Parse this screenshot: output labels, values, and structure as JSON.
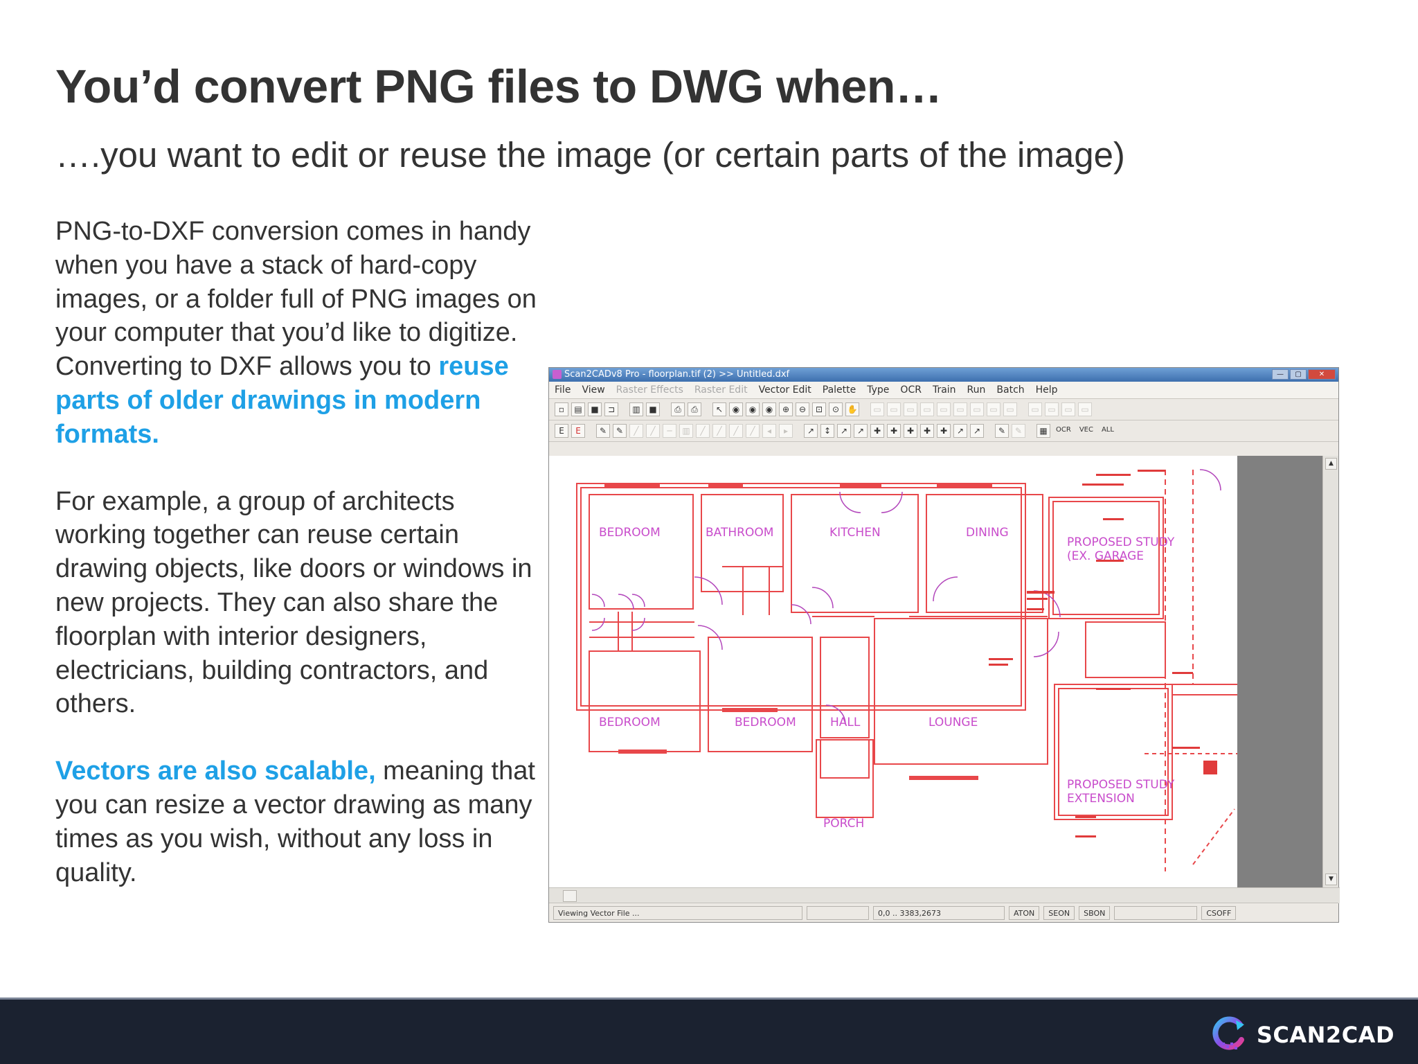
{
  "slide": {
    "title": "You’d convert PNG files to DWG when…",
    "subtitle": "….you want to edit or reuse the image (or certain parts of the image)",
    "para1_text": "PNG-to-DXF conversion comes in handy when you have a stack of hard-copy images, or a folder full of PNG images on your computer that you’d like to digitize. Converting to DXF allows you to ",
    "para1_highlight": "reuse parts of older drawings in modern formats.",
    "para2_text": "For example, a group of architects working together can reuse certain drawing objects, like doors or windows in new projects. They can also share the floorplan with interior designers, electricians, building contractors, and others.",
    "para3_highlight": "Vectors are also scalable,",
    "para3_text": " meaning that you can resize a vector drawing as many times as you wish, without any loss in quality.",
    "highlight_color": "#1ea0e6"
  },
  "app_window": {
    "title": "Scan2CADv8 Pro  -  floorplan.tif (2) >> Untitled.dxf",
    "window_buttons": [
      "—",
      "▢",
      "✕"
    ],
    "menu": [
      {
        "label": "File",
        "enabled": true
      },
      {
        "label": "View",
        "enabled": true
      },
      {
        "label": "Raster Effects",
        "enabled": false
      },
      {
        "label": "Raster Edit",
        "enabled": false
      },
      {
        "label": "Vector Edit",
        "enabled": true
      },
      {
        "label": "Palette",
        "enabled": true
      },
      {
        "label": "Type",
        "enabled": true
      },
      {
        "label": "OCR",
        "enabled": true
      },
      {
        "label": "Train",
        "enabled": true
      },
      {
        "label": "Run",
        "enabled": true
      },
      {
        "label": "Batch",
        "enabled": true
      },
      {
        "label": "Help",
        "enabled": true
      }
    ],
    "toolbar_text_buttons": [
      "OCR",
      "VEC",
      "ALL"
    ],
    "toolbar_letters": [
      "E",
      "E"
    ],
    "status": {
      "message": "Viewing Vector File ...",
      "coords": "0,0 .. 3383,2673",
      "aton": "ATON",
      "seon": "SEON",
      "sbon": "SBON",
      "csoff": "CSOFF"
    },
    "rooms": {
      "bedroom_top": "BEDROOM",
      "bathroom": "BATHROOM",
      "kitchen": "KITCHEN",
      "dining": "DINING",
      "study_line1": "PROPOSED STUDY",
      "study_line2": "(EX. GARAGE",
      "bedroom_bl": "BEDROOM",
      "bedroom_bm": "BEDROOM",
      "hall": "HALL",
      "lounge": "LOUNGE",
      "study_ext_line1": "PROPOSED STUDY",
      "study_ext_line2": "EXTENSION",
      "porch": "PORCH"
    },
    "colors": {
      "wall": "#e8474a",
      "label": "#c84ccb"
    }
  },
  "footer": {
    "brand": "SCAN2CAD",
    "background": "#1b2230"
  }
}
